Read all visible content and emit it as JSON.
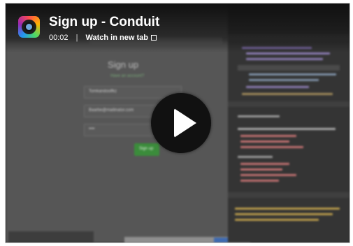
{
  "video": {
    "title": "Sign up - Conduit",
    "duration": "00:02",
    "separator": "|",
    "watch_link": "Watch in new tab"
  },
  "blurred_page": {
    "heading": "Sign up",
    "have_account": "Have an account?",
    "username_value": "Tomkandoolfkz",
    "email_value": "Baarbe@mailinator.com",
    "password_value": "••••",
    "button_label": "Sign up"
  },
  "colors": {
    "play_button": "#111111",
    "brand_green": "#3b8c3b"
  },
  "icons": {
    "logo": "recorder-logo-icon",
    "external": "external-link-icon",
    "play": "play-icon"
  }
}
